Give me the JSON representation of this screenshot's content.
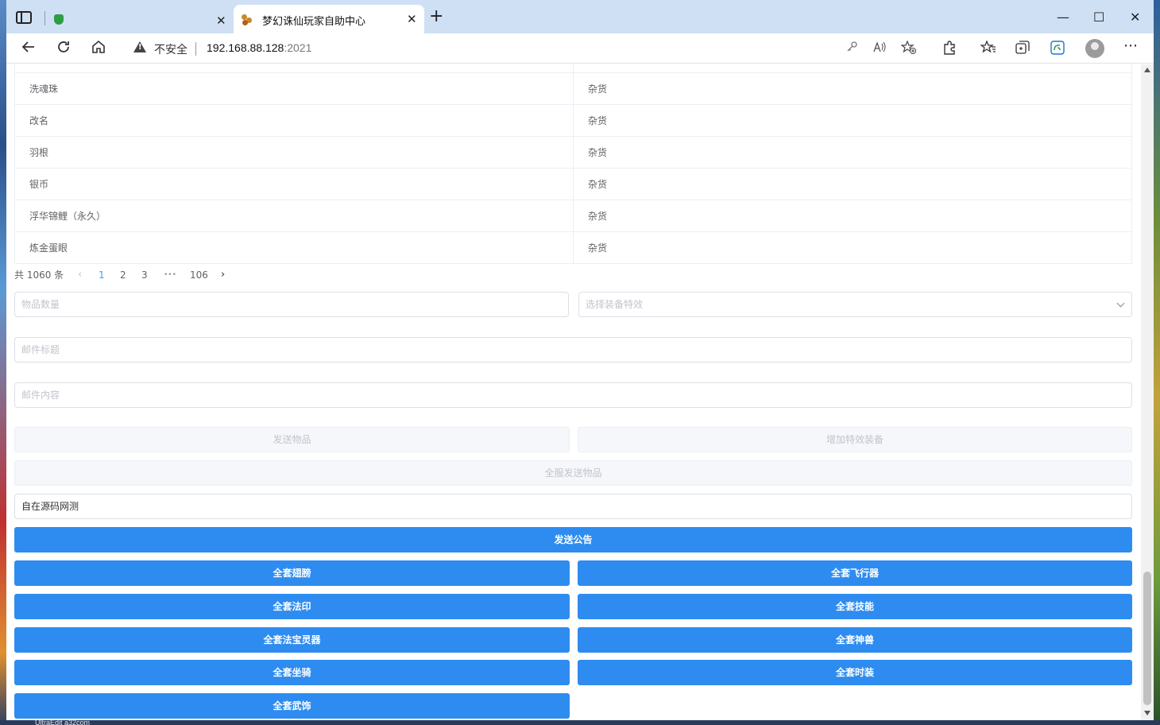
{
  "browser": {
    "tabs": [
      {
        "title": ""
      },
      {
        "title": "梦幻诛仙玩家自助中心"
      }
    ],
    "close_glyph": "✕",
    "new_tab_glyph": "+",
    "window": {
      "minimize": "—",
      "maximize": "☐",
      "close": "✕"
    },
    "insecure_label": "不安全",
    "url_host": "192.168.88.128",
    "url_port": ":2021"
  },
  "table": {
    "rows": [
      {
        "name": "洗魂珠",
        "type": "杂货"
      },
      {
        "name": "改名",
        "type": "杂货"
      },
      {
        "name": "羽根",
        "type": "杂货"
      },
      {
        "name": "银币",
        "type": "杂货"
      },
      {
        "name": "浮华锦鲤（永久）",
        "type": "杂货"
      },
      {
        "name": "炼金蛋眼",
        "type": "杂货"
      }
    ]
  },
  "pagination": {
    "total": "共 1060 条",
    "pages": [
      "1",
      "2",
      "3",
      "•••",
      "106"
    ],
    "prev": "‹",
    "next": "›",
    "current": "1"
  },
  "form": {
    "quantity_placeholder": "物品数量",
    "effect_placeholder": "选择装备特效",
    "mail_title_placeholder": "邮件标题",
    "mail_content_placeholder": "邮件内容",
    "send_item": "发送物品",
    "add_effect_equipment": "增加特效装备",
    "server_send_item": "全服发送物品",
    "announcement_value": "自在源码网测",
    "send_announcement": "发送公告"
  },
  "sets": {
    "wings": "全套翅膀",
    "aircraft": "全套飞行器",
    "seal": "全套法印",
    "skills": "全套技能",
    "treasure_spirit": "全套法宝灵器",
    "beast": "全套神兽",
    "mount": "全套坐骑",
    "fashion": "全套时装",
    "weapon_decor": "全套武饰"
  },
  "taskbar_text": "UltraEdit     a32com",
  "colors": {
    "primary": "#2e8cf0",
    "link_active": "#409eff",
    "tab_strip": "#cfe0f5"
  }
}
